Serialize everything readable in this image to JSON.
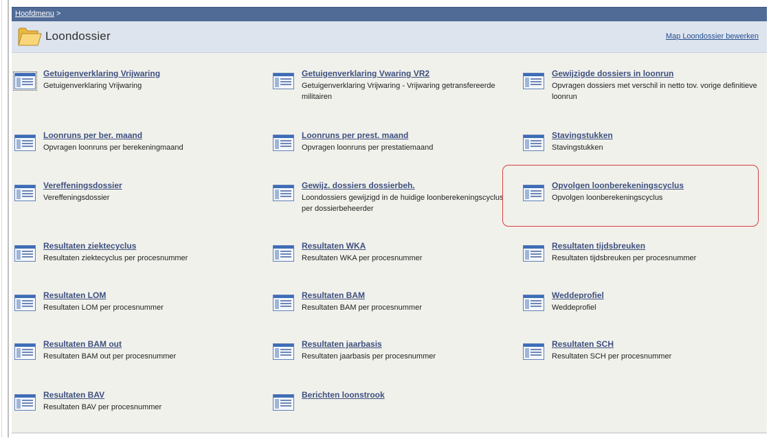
{
  "breadcrumb": {
    "home_link": "Hoofdmenu",
    "separator": ">"
  },
  "header": {
    "title": "Loondossier",
    "edit_link": "Map Loondossier bewerken",
    "folder_icon": "folder-icon"
  },
  "accent_color": "#4f6b96",
  "highlight_color": "#d63c3c",
  "items": [
    {
      "title": "Getuigenverklaring Vrijwaring",
      "desc": "Getuigenverklaring Vrijwaring"
    },
    {
      "title": "Getuigenverklaring Vwaring VR2",
      "desc": "Getuigenverklaring Vrijwaring - Vrijwaring getransfereerde militairen"
    },
    {
      "title": "Gewijzigde dossiers in loonrun",
      "desc": "Opvragen dossiers met verschil in netto tov. vorige definitieve loonrun"
    },
    {
      "title": "Loonruns per ber. maand",
      "desc": "Opvragen loonruns per berekeningmaand"
    },
    {
      "title": "Loonruns per prest. maand",
      "desc": "Opvragen loonruns per prestatiemaand"
    },
    {
      "title": "Stavingstukken",
      "desc": "Stavingstukken"
    },
    {
      "title": "Vereffeningsdossier",
      "desc": "Vereffeningsdossier"
    },
    {
      "title": "Gewijz. dossiers dossierbeh.",
      "desc": "Loondossiers gewijzigd in de huidige loonberekeningscyclus per dossierbeheerder"
    },
    {
      "title": "Opvolgen loonberekeningscyclus",
      "desc": "Opvolgen loonberekeningscyclus"
    },
    {
      "title": "Resultaten ziektecyclus",
      "desc": "Resultaten ziektecyclus per procesnummer"
    },
    {
      "title": "Resultaten WKA",
      "desc": "Resultaten WKA per procesnummer"
    },
    {
      "title": "Resultaten tijdsbreuken",
      "desc": "Resultaten tijdsbreuken per procesnummer"
    },
    {
      "title": "Resultaten LOM",
      "desc": "Resultaten LOM per procesnummer"
    },
    {
      "title": "Resultaten BAM",
      "desc": "Resultaten BAM per procesnummer"
    },
    {
      "title": "Weddeprofiel",
      "desc": "Weddeprofiel"
    },
    {
      "title": "Resultaten BAM out",
      "desc": "Resultaten BAM out per procesnummer"
    },
    {
      "title": "Resultaten jaarbasis",
      "desc": "Resultaten jaarbasis per procesnummer"
    },
    {
      "title": "Resultaten SCH",
      "desc": "Resultaten SCH per procesnummer"
    },
    {
      "title": "Resultaten BAV",
      "desc": "Resultaten BAV per procesnummer"
    },
    {
      "title": "Berichten loonstrook",
      "desc": ""
    }
  ]
}
